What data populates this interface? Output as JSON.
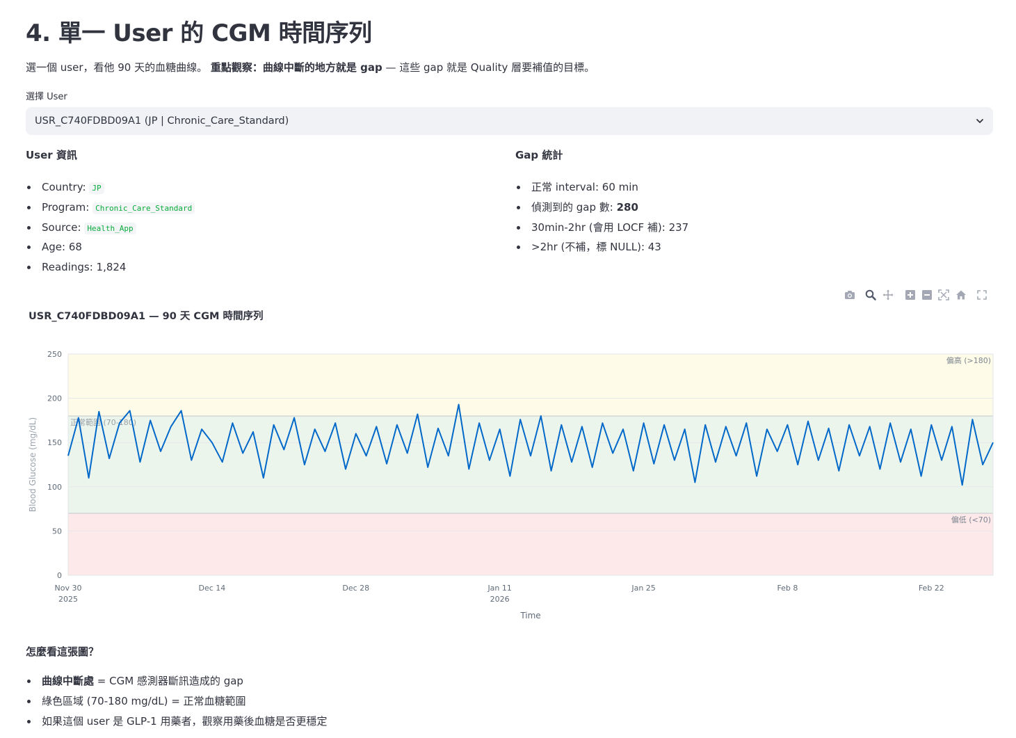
{
  "header": {
    "title": "4. 單一 User 的 CGM 時間序列"
  },
  "intro": {
    "before": "選一個 user，看他 90 天的血糖曲線。",
    "bold": "重點觀察：曲線中斷的地方就是 gap",
    "after": " — 這些 gap 就是 Quality 層要補值的目標。"
  },
  "user_select": {
    "label": "選擇 User",
    "value": "USR_C740FDBD09A1 (JP | Chronic_Care_Standard)"
  },
  "user_info": {
    "heading": "User 資訊",
    "country_label": "Country: ",
    "country": "JP",
    "program_label": "Program: ",
    "program": "Chronic_Care_Standard",
    "source_label": "Source: ",
    "source": "Health_App",
    "age": "Age: 68",
    "readings": "Readings: 1,824"
  },
  "gap_stats": {
    "heading": "Gap 統計",
    "interval": "正常 interval: 60 min",
    "gap_count_label": "偵測到的 gap 數: ",
    "gap_count": "280",
    "locf": "30min-2hr (會用 LOCF 補): 237",
    "null_count": ">2hr (不補，標 NULL): 43"
  },
  "toolbar": [
    "camera-icon",
    "zoom-icon",
    "pan-icon",
    "zoom-in-icon",
    "zoom-out-icon",
    "autoscale-icon",
    "reset-axes-icon",
    "fullscreen-icon"
  ],
  "chart_data": {
    "type": "line",
    "title": "USR_C740FDBD09A1 — 90 天 CGM 時間序列",
    "xlabel": "Time",
    "ylabel": "Blood Glucose (mg/dL)",
    "ylim": [
      0,
      250
    ],
    "yticks": [
      0,
      50,
      100,
      150,
      200,
      250
    ],
    "xlim": [
      "2025-11-30",
      "2026-02-28"
    ],
    "xticks": [
      {
        "date": "2025-11-30",
        "label": "Nov 30",
        "sub": "2025"
      },
      {
        "date": "2025-12-14",
        "label": "Dec 14",
        "sub": ""
      },
      {
        "date": "2025-12-28",
        "label": "Dec 28",
        "sub": ""
      },
      {
        "date": "2026-01-11",
        "label": "Jan 11",
        "sub": "2026"
      },
      {
        "date": "2026-01-25",
        "label": "Jan 25",
        "sub": ""
      },
      {
        "date": "2026-02-08",
        "label": "Feb 8",
        "sub": ""
      },
      {
        "date": "2026-02-22",
        "label": "Feb 22",
        "sub": ""
      }
    ],
    "bands": [
      {
        "from": 180,
        "to": 250,
        "label": "偏高 (>180)",
        "color": "#fefce8"
      },
      {
        "from": 70,
        "to": 180,
        "label": "正常範圍 (70-180)",
        "color": "#ebf5ec"
      },
      {
        "from": 0,
        "to": 70,
        "label": "偏低 (<70)",
        "color": "#fde9ea"
      }
    ],
    "series": [
      {
        "color": "#0068c9",
        "points": [
          [
            "2025-11-30",
            135
          ],
          [
            "2025-12-01",
            178
          ],
          [
            "2025-12-02",
            110
          ],
          [
            "2025-12-03",
            185
          ],
          [
            "2025-12-04",
            132
          ],
          [
            "2025-12-05",
            172
          ],
          [
            "2025-12-06",
            186
          ],
          [
            "2025-12-07",
            128
          ],
          [
            "2025-12-08",
            175
          ],
          [
            "2025-12-09",
            140
          ],
          [
            "2025-12-10",
            168
          ],
          [
            "2025-12-11",
            186
          ],
          [
            "2025-12-12",
            130
          ],
          [
            "2025-12-13",
            165
          ],
          [
            "2025-12-14",
            150
          ],
          [
            "2025-12-15",
            128
          ],
          [
            "2025-12-16",
            172
          ],
          [
            "2025-12-17",
            138
          ],
          [
            "2025-12-18",
            162
          ],
          [
            "2025-12-19",
            110
          ],
          [
            "2025-12-20",
            170
          ],
          [
            "2025-12-21",
            142
          ],
          [
            "2025-12-22",
            178
          ],
          [
            "2025-12-23",
            125
          ],
          [
            "2025-12-24",
            165
          ],
          [
            "2025-12-25",
            140
          ],
          [
            "2025-12-26",
            172
          ],
          [
            "2025-12-27",
            120
          ],
          [
            "2025-12-28",
            160
          ],
          [
            "2025-12-29",
            135
          ],
          [
            "2025-12-30",
            168
          ],
          [
            "2025-12-31",
            126
          ],
          [
            "2026-01-01",
            170
          ],
          [
            "2026-01-02",
            138
          ],
          [
            "2026-01-03",
            182
          ],
          [
            "2026-01-04",
            122
          ],
          [
            "2026-01-05",
            166
          ],
          [
            "2026-01-06",
            135
          ],
          [
            "2026-01-07",
            193
          ],
          [
            "2026-01-08",
            120
          ],
          [
            "2026-01-09",
            172
          ],
          [
            "2026-01-10",
            130
          ],
          [
            "2026-01-11",
            165
          ],
          [
            "2026-01-12",
            112
          ],
          [
            "2026-01-13",
            176
          ],
          [
            "2026-01-14",
            135
          ],
          [
            "2026-01-15",
            180
          ],
          [
            "2026-01-16",
            118
          ],
          [
            "2026-01-17",
            170
          ],
          [
            "2026-01-18",
            128
          ],
          [
            "2026-01-19",
            168
          ],
          [
            "2026-01-20",
            122
          ],
          [
            "2026-01-21",
            172
          ],
          [
            "2026-01-22",
            138
          ],
          [
            "2026-01-23",
            165
          ],
          [
            "2026-01-24",
            118
          ],
          [
            "2026-01-25",
            172
          ],
          [
            "2026-01-26",
            126
          ],
          [
            "2026-01-27",
            170
          ],
          [
            "2026-01-28",
            130
          ],
          [
            "2026-01-29",
            165
          ],
          [
            "2026-01-30",
            105
          ],
          [
            "2026-01-31",
            170
          ],
          [
            "2026-02-01",
            128
          ],
          [
            "2026-02-02",
            168
          ],
          [
            "2026-02-03",
            135
          ],
          [
            "2026-02-04",
            172
          ],
          [
            "2026-02-05",
            112
          ],
          [
            "2026-02-06",
            165
          ],
          [
            "2026-02-07",
            140
          ],
          [
            "2026-02-08",
            170
          ],
          [
            "2026-02-09",
            125
          ],
          [
            "2026-02-10",
            174
          ],
          [
            "2026-02-11",
            130
          ],
          [
            "2026-02-12",
            166
          ],
          [
            "2026-02-13",
            118
          ],
          [
            "2026-02-14",
            170
          ],
          [
            "2026-02-15",
            135
          ],
          [
            "2026-02-16",
            168
          ],
          [
            "2026-02-17",
            120
          ],
          [
            "2026-02-18",
            172
          ],
          [
            "2026-02-19",
            128
          ],
          [
            "2026-02-20",
            165
          ],
          [
            "2026-02-21",
            112
          ],
          [
            "2026-02-22",
            170
          ],
          [
            "2026-02-23",
            130
          ],
          [
            "2026-02-24",
            168
          ],
          [
            "2026-02-25",
            102
          ],
          [
            "2026-02-26",
            176
          ],
          [
            "2026-02-27",
            125
          ],
          [
            "2026-02-28",
            150
          ]
        ]
      }
    ]
  },
  "howto": {
    "heading": "怎麼看這張圖？",
    "item1_bold": "曲線中斷處",
    "item1_rest": " = CGM 感測器斷訊造成的 gap",
    "item2": "綠色區域 (70-180 mg/dL) = 正常血糖範圍",
    "item3": "如果這個 user 是 GLP-1 用藥者，觀察用藥後血糖是否更穩定"
  }
}
